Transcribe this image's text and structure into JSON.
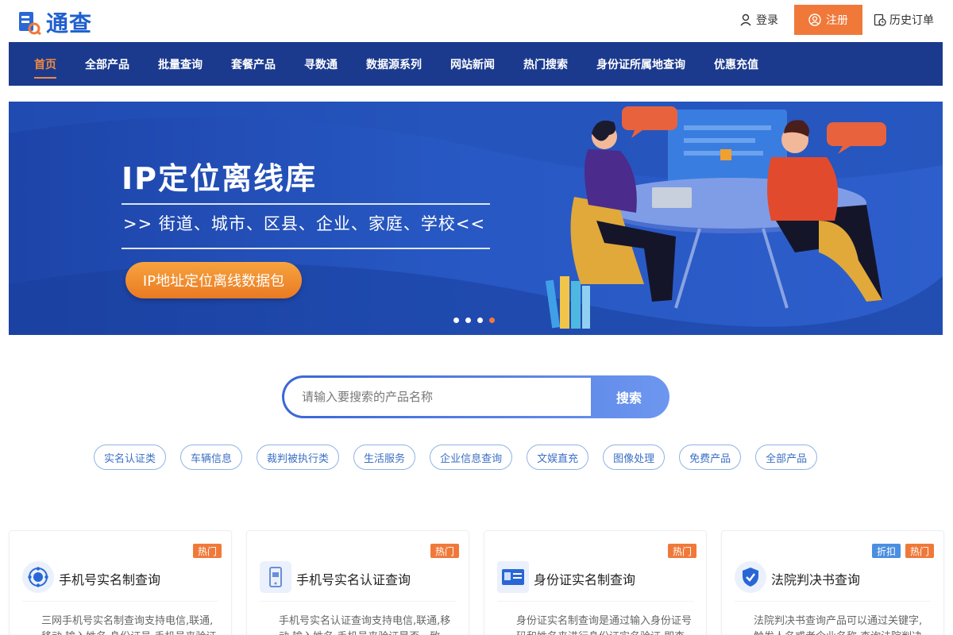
{
  "header": {
    "logo_text": "通查",
    "login": "登录",
    "register": "注册",
    "history": "历史订单"
  },
  "nav": {
    "items": [
      {
        "label": "首页",
        "active": true
      },
      {
        "label": "全部产品"
      },
      {
        "label": "批量查询"
      },
      {
        "label": "套餐产品"
      },
      {
        "label": "寻数通"
      },
      {
        "label": "数据源系列"
      },
      {
        "label": "网站新闻"
      },
      {
        "label": "热门搜索"
      },
      {
        "label": "身份证所属地查询"
      },
      {
        "label": "优惠充值"
      }
    ]
  },
  "banner": {
    "title": "IP定位离线库",
    "subtitle": ">> 街道、城市、区县、企业、家庭、学校<<",
    "button": "IP地址定位离线数据包",
    "slides": 4,
    "active_slide": 4
  },
  "search": {
    "placeholder": "请输入要搜索的产品名称",
    "button": "搜索"
  },
  "tags": [
    "实名认证类",
    "车辆信息",
    "裁判被执行类",
    "生活服务",
    "企业信息查询",
    "文娱直充",
    "图像处理",
    "免费产品",
    "全部产品"
  ],
  "cards": [
    {
      "title": "手机号实名制查询",
      "badges": [
        "热门"
      ],
      "desc": "三网手机号实名制查询支持电信,联通,移动,输入姓名,身份证号,手机号来验证",
      "icon": "phone-radar-icon"
    },
    {
      "title": "手机号实名认证查询",
      "badges": [
        "热门"
      ],
      "desc": "手机号实名认证查询支持电信,联通,移动,输入姓名,手机号来验证是否一致",
      "icon": "mobile-phone-icon"
    },
    {
      "title": "身份证实名制查询",
      "badges": [
        "热门"
      ],
      "desc": "身份证实名制查询是通过输入身份证号码和姓名来进行身份证实名验证,即查",
      "icon": "id-card-icon"
    },
    {
      "title": "法院判决书查询",
      "badges": [
        "折扣",
        "热门"
      ],
      "desc": "法院判决书查询产品可以通过关键字,触发人名或者企业名称,查询法院判决书",
      "icon": "shield-check-icon"
    }
  ],
  "colors": {
    "brand": "#1f5fcf",
    "nav_bg": "#1b3a8e",
    "accent": "#f0793a"
  }
}
